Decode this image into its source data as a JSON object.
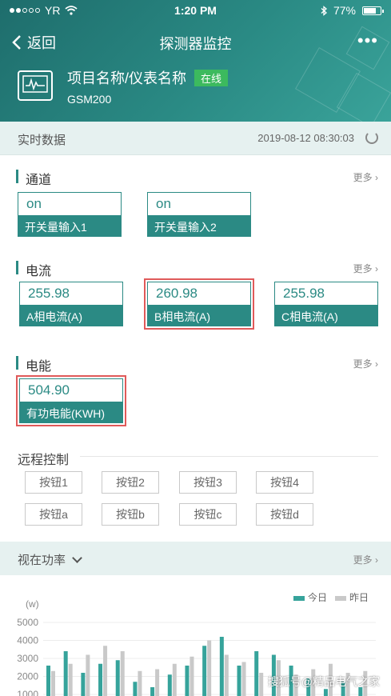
{
  "status_bar": {
    "carrier": "YR",
    "time": "1:20 PM",
    "battery": "77%",
    "battery_level": 0.77
  },
  "nav": {
    "back_label": "返回",
    "title": "探测器监控",
    "more_label": "•••"
  },
  "device": {
    "name": "项目名称/仪表名称",
    "status": "在线",
    "model": "GSM200"
  },
  "realtime": {
    "label": "实时数据",
    "timestamp": "2019-08-12 08:30:03"
  },
  "channel": {
    "title": "通道",
    "more": "更多",
    "cards": [
      {
        "value": "on",
        "name": "开关量输入1"
      },
      {
        "value": "on",
        "name": "开关量输入2"
      }
    ]
  },
  "current": {
    "title": "电流",
    "more": "更多",
    "cards": [
      {
        "value": "255.98",
        "name": "A相电流(A)"
      },
      {
        "value": "260.98",
        "name": "B相电流(A)"
      },
      {
        "value": "255.98",
        "name": "C相电流(A)"
      }
    ]
  },
  "energy": {
    "title": "电能",
    "more": "更多",
    "cards": [
      {
        "value": "504.90",
        "name": "有功电能(KWH)"
      }
    ]
  },
  "remote": {
    "title": "远程控制",
    "buttons": [
      "按钮1",
      "按钮2",
      "按钮3",
      "按钮4",
      "按钮a",
      "按钮b",
      "按钮c",
      "按钮d"
    ]
  },
  "power": {
    "label": "视在功率",
    "more": "更多"
  },
  "colors": {
    "accent": "#2b8a84",
    "today": "#36a39b",
    "yesterday": "#c9c9c9",
    "online": "#3cba5e",
    "highlight": "#e05a5a"
  },
  "chart_data": {
    "type": "bar",
    "ylabel": "(w)",
    "y_ticks": [
      "5000",
      "4000",
      "3000",
      "2000",
      "1000"
    ],
    "ylim": [
      0,
      5000
    ],
    "grid": true,
    "legend_position": "top-right",
    "series": [
      {
        "name": "今日",
        "values": [
          2600,
          3400,
          2200,
          2700,
          2900,
          1700,
          1400,
          2100,
          2600,
          3700,
          4200,
          2600,
          3400,
          3200,
          2600,
          1900,
          1300,
          1700,
          1400
        ]
      },
      {
        "name": "昨日",
        "values": [
          2300,
          2700,
          3200,
          3700,
          3400,
          2300,
          2400,
          2700,
          3100,
          4000,
          3200,
          2800,
          2200,
          2900,
          2100,
          2400,
          2700,
          2200,
          2300
        ]
      }
    ]
  },
  "watermark": "搜狐号@精品电气之家"
}
